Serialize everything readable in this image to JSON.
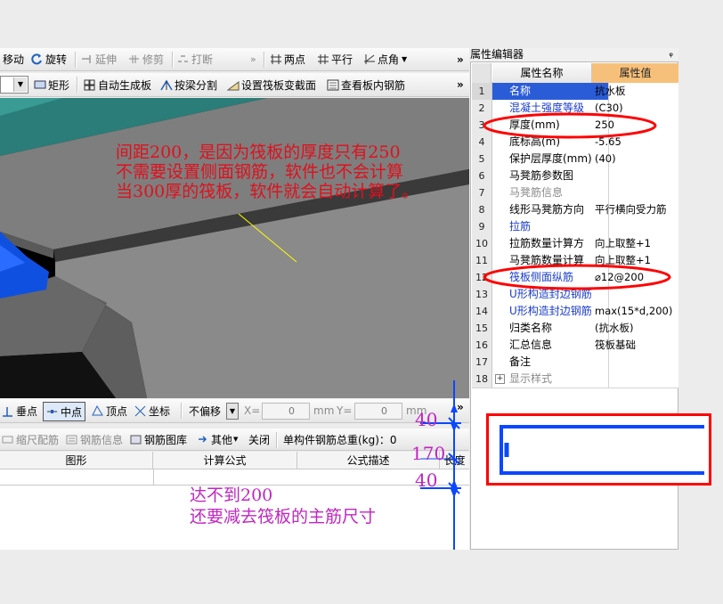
{
  "toolbar1": {
    "move": "移动",
    "rotate": "旋转",
    "extend": "延伸",
    "trim": "修剪",
    "break": "打断",
    "two_points": "两点",
    "parallel": "平行",
    "angle": "点角",
    "overflow": "»"
  },
  "toolbar2": {
    "rect": "矩形",
    "auto_gen": "自动生成板",
    "split_by_beam": "按梁分割",
    "set_slope": "设置筏板变截面",
    "view_rebar": "查看板内钢筋",
    "overflow": "»"
  },
  "snap_bar": {
    "vertical": "垂点",
    "midpoint": "中点",
    "vertex": "顶点",
    "coordinate": "坐标",
    "offset_mode": "不偏移",
    "x_label": "X=",
    "x_value": "0",
    "unit_x": "mm",
    "y_label": "Y=",
    "y_value": "0",
    "unit_y": "mm",
    "overflow": "»"
  },
  "rebar_bar": {
    "scale_rebar": "缩尺配筋",
    "rebar_info": "钢筋信息",
    "rebar_library": "钢筋图库",
    "other": "其他",
    "close": "关闭",
    "total_weight": "单构件钢筋总重(kg)：0"
  },
  "rebar_table": {
    "headers": [
      "图形",
      "计算公式",
      "公式描述",
      "长度"
    ]
  },
  "property_panel": {
    "title": "属性编辑器",
    "pin": "ᵩ",
    "header_name": "属性名称",
    "header_value": "属性值",
    "rows": [
      {
        "n": "1",
        "name": "名称",
        "value": "抗水板",
        "style": "blue-sel"
      },
      {
        "n": "2",
        "name": "混凝土强度等级",
        "value": "(C30)",
        "style": "blue"
      },
      {
        "n": "3",
        "name": "厚度(mm)",
        "value": "250",
        "style": ""
      },
      {
        "n": "4",
        "name": "底标高(m)",
        "value": "-5.65",
        "style": ""
      },
      {
        "n": "5",
        "name": "保护层厚度(mm)",
        "value": "(40)",
        "style": ""
      },
      {
        "n": "6",
        "name": "马凳筋参数图",
        "value": "",
        "style": ""
      },
      {
        "n": "7",
        "name": "马凳筋信息",
        "value": "",
        "style": "gray"
      },
      {
        "n": "8",
        "name": "线形马凳筋方向",
        "value": "平行横向受力筋",
        "style": ""
      },
      {
        "n": "9",
        "name": "拉筋",
        "value": "",
        "style": "blue"
      },
      {
        "n": "10",
        "name": "拉筋数量计算方",
        "value": "向上取整+1",
        "style": ""
      },
      {
        "n": "11",
        "name": "马凳筋数量计算",
        "value": "向上取整+1",
        "style": ""
      },
      {
        "n": "12",
        "name": "筏板侧面纵筋",
        "value": "⌀12@200",
        "style": "blue"
      },
      {
        "n": "13",
        "name": "U形构造封边钢筋",
        "value": "",
        "style": "blue"
      },
      {
        "n": "14",
        "name": "U形构造封边钢筋",
        "value": "max(15*d,200)",
        "style": "blue"
      },
      {
        "n": "15",
        "name": "归类名称",
        "value": "(抗水板)",
        "style": ""
      },
      {
        "n": "16",
        "name": "汇总信息",
        "value": "筏板基础",
        "style": ""
      },
      {
        "n": "17",
        "name": "备注",
        "value": "",
        "style": ""
      },
      {
        "n": "18",
        "name": "显示样式",
        "value": "",
        "style": "gray-expand"
      }
    ]
  },
  "annotations": {
    "main_note": [
      "间距200，是因为筏板的厚度只有250",
      "不需要设置侧面钢筋，软件也不会计算",
      "当300厚的筏板，软件就会自动计算了。"
    ],
    "bottom_note": [
      "达不到200",
      "还要减去筏板的主筋尺寸"
    ],
    "dim_top": "40",
    "dim_mid": "170",
    "dim_bottom": "40"
  },
  "colors": {
    "accent_red": "#ff0000",
    "note_red": "#e0101c",
    "note_magenta": "#c026c0",
    "dim_blue": "#0a47ff",
    "header_value_bg": "#f7c07a"
  }
}
